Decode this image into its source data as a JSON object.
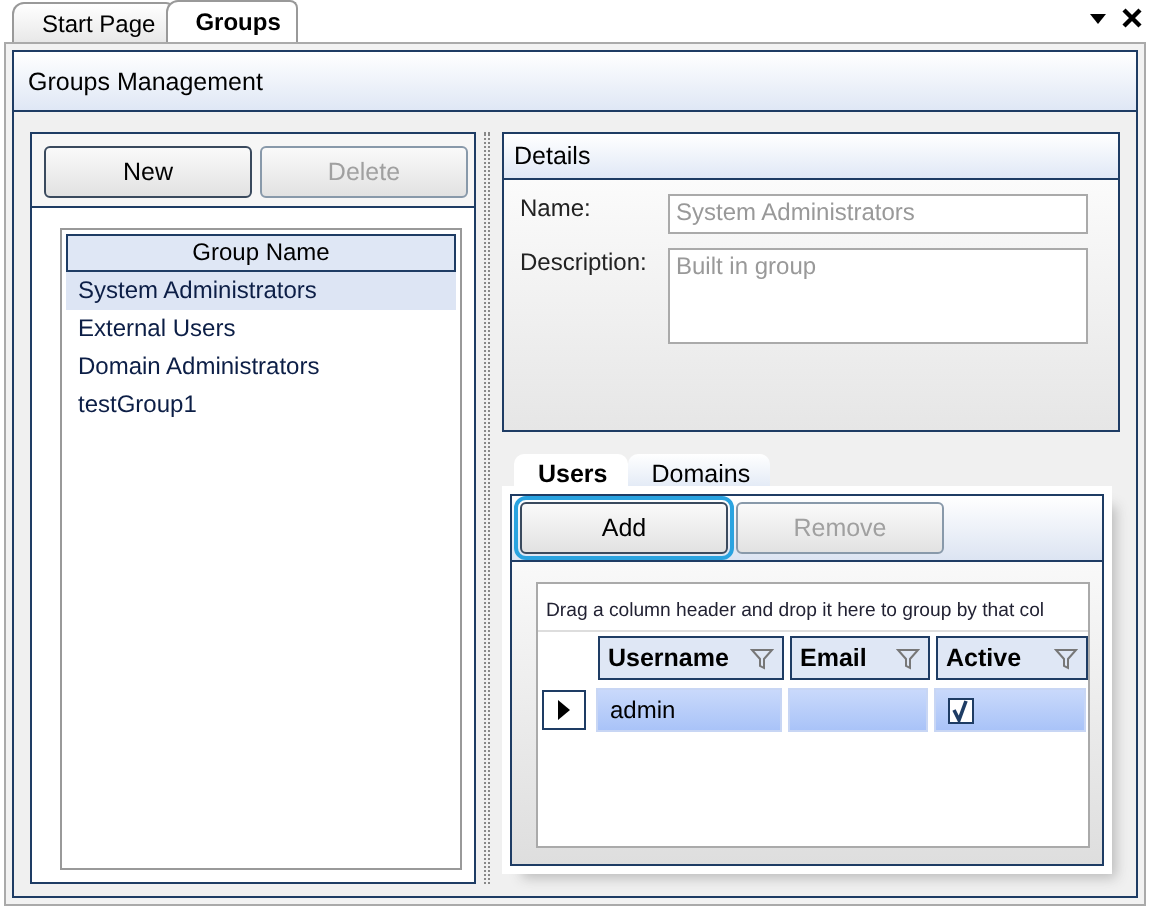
{
  "doc_tabs": [
    {
      "label": "Start Page",
      "selected": false
    },
    {
      "label": "Groups",
      "selected": true
    }
  ],
  "panel": {
    "title": "Groups Management"
  },
  "groups": {
    "buttons": [
      {
        "label": "New",
        "disabled": false
      },
      {
        "label": "Delete",
        "disabled": true
      }
    ],
    "column": "Group Name",
    "rows": [
      {
        "name": "System Administrators",
        "selected": true
      },
      {
        "name": "External Users",
        "selected": false
      },
      {
        "name": "Domain Administrators",
        "selected": false
      },
      {
        "name": "testGroup1",
        "selected": false
      }
    ]
  },
  "details": {
    "title": "Details",
    "fields": [
      {
        "label": "Name:",
        "value": "System Administrators",
        "kind": "line",
        "disabled": true
      },
      {
        "label": "Description:",
        "value": "Built in group",
        "kind": "area",
        "disabled": true
      }
    ]
  },
  "member_tabs": [
    {
      "label": "Users",
      "selected": true
    },
    {
      "label": "Domains",
      "selected": false
    }
  ],
  "members": {
    "buttons": [
      {
        "label": "Add",
        "disabled": false,
        "focused": true
      },
      {
        "label": "Remove",
        "disabled": true,
        "focused": false
      }
    ],
    "group_hint": "Drag a column header and drop it here to group by that col",
    "columns": [
      "Username",
      "Email",
      "Active"
    ],
    "rows": [
      {
        "username": "admin",
        "active": true,
        "selected": true,
        "current": true
      }
    ]
  }
}
